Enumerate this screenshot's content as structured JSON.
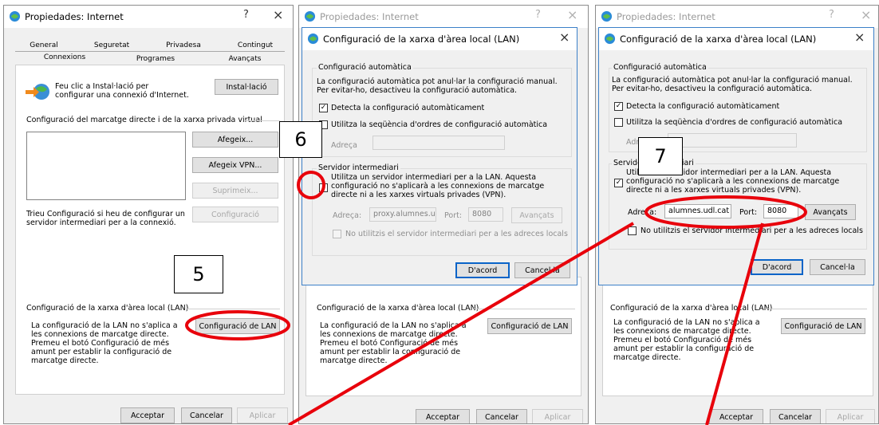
{
  "colors": {
    "annotation_red": "#e8000b",
    "focus_blue": "#0a64c8"
  },
  "window1": {
    "title": "Propiedades: Internet",
    "help": "?",
    "close": "×",
    "tabs_row1": [
      "General",
      "Seguretat",
      "Privadesa",
      "Contingut"
    ],
    "tabs_row2": [
      "Connexions",
      "Programes",
      "Avançats"
    ],
    "setup_text": "Feu clic a Instal·lació per configurar una connexió d'Internet.",
    "setup_button": "Instal·lació",
    "dialup_group": "Configuració del marcatge directe i de la xarxa privada virtual",
    "add_button": "Afegeix...",
    "add_vpn_button": "Afegeix VPN...",
    "remove_button": "Suprimeix...",
    "settings_text": "Trieu Configuració si heu de configurar un servidor intermediari per a la connexió.",
    "settings_button": "Configuració",
    "lan_group": "Configuració de la xarxa d'àrea local (LAN)",
    "lan_text": "La configuració de la LAN no s'aplica a les connexions de marcatge directe. Premeu el botó Configuració de més amunt per establir la configuració de marcatge directe.",
    "lan_button": "Configuració de LAN",
    "ok_button": "Acceptar",
    "cancel_button": "Cancelar",
    "apply_button": "Aplicar"
  },
  "lan_dialog": {
    "title": "Configuració de la xarxa d'àrea local (LAN)",
    "close": "×",
    "auto_group": "Configuració automàtica",
    "auto_text": "La configuració automàtica pot anul·lar la configuració manual. Per evitar-ho, desactiveu la configuració automàtica.",
    "auto_detect": "Detecta la configuració automàticament",
    "script": "Utilitza la seqüència d'ordres de configuració automàtica",
    "address_label": "Adreça",
    "proxy_group": "Servidor intermediari",
    "proxy_text": "Utilitza un servidor intermediari per a la LAN. Aquesta configuració no s'aplicarà a les connexions de marcatge directe ni a les xarxes virtuals privades (VPN).",
    "proxy_address_label": "Adreça:",
    "port_label": "Port:",
    "advanced_button": "Avançats",
    "bypass": "No utilitzis el servidor intermediari per a les adreces locals",
    "ok_button": "D'acord",
    "cancel_button": "Cancel·la"
  },
  "dialog6": {
    "proxy_address": "proxy.alumnes.u",
    "port": "8080"
  },
  "dialog7": {
    "proxy_address": "alumnes.udl.cat",
    "port": "8080"
  },
  "callouts": [
    "5",
    "6",
    "7"
  ]
}
